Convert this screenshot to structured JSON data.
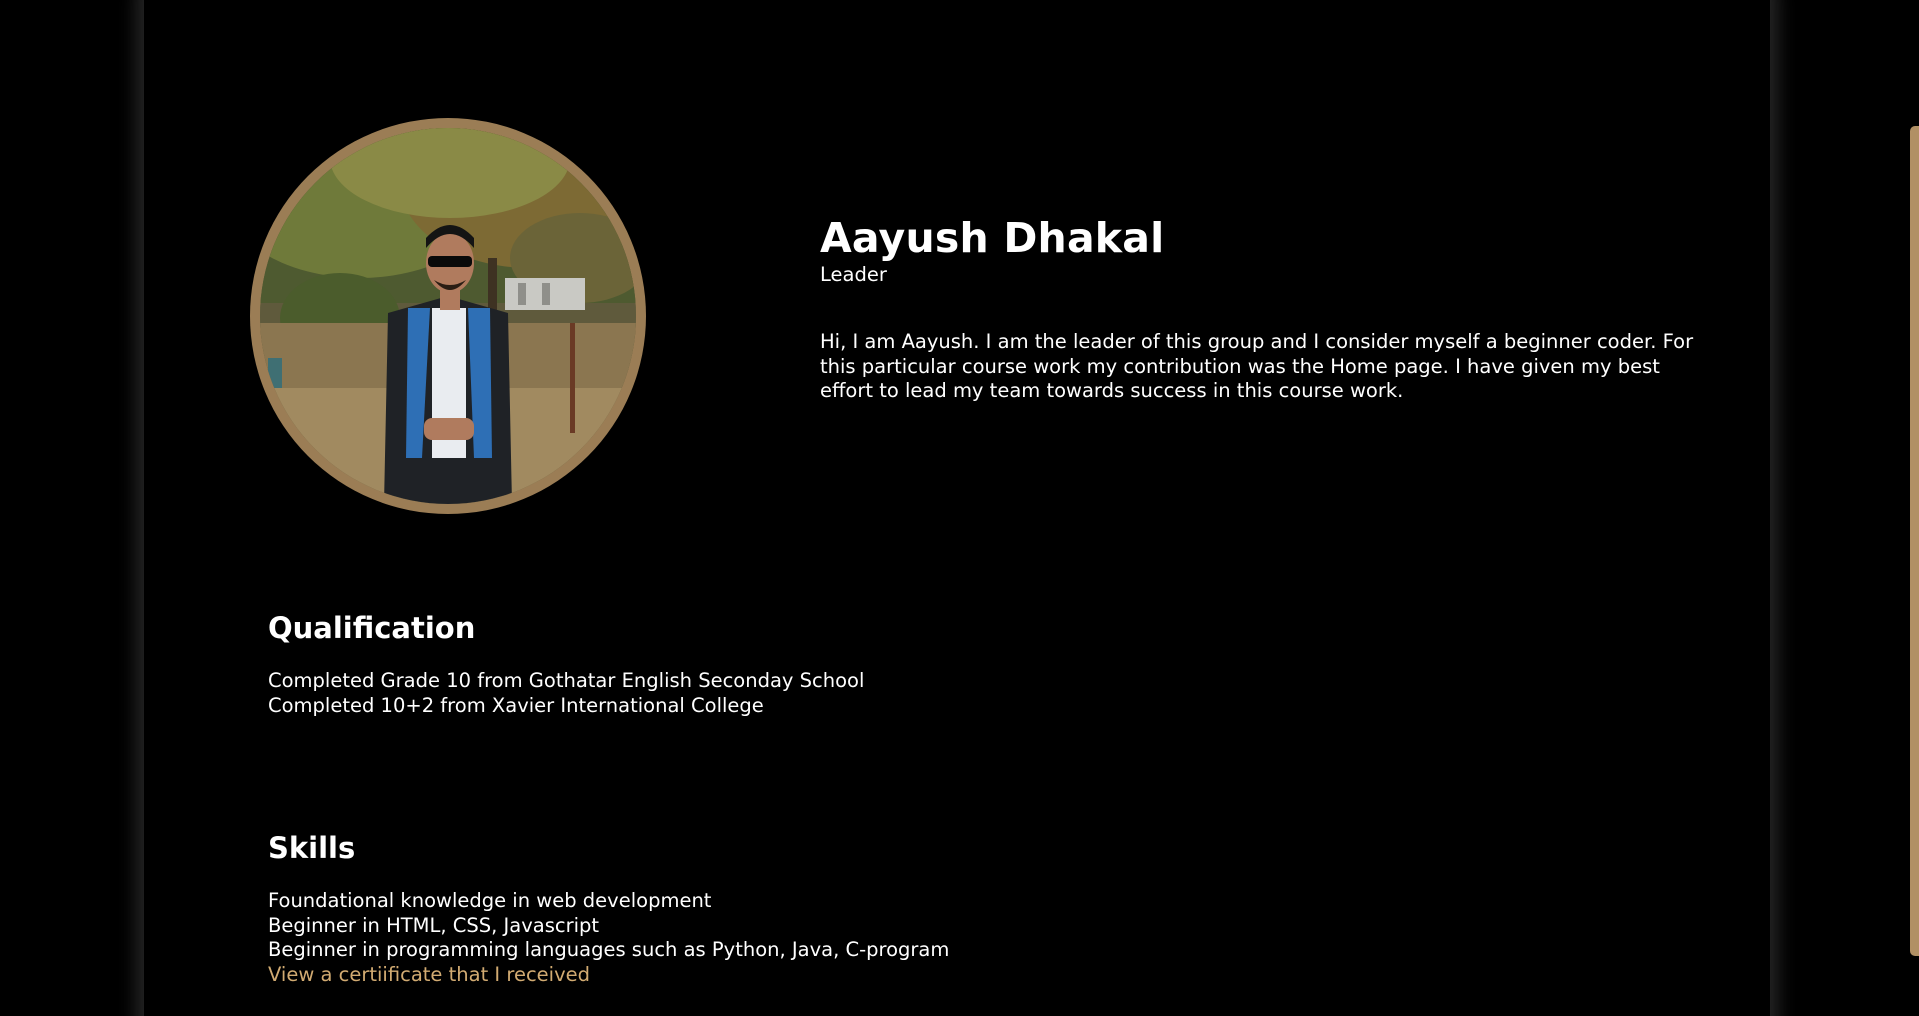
{
  "profile": {
    "photo_icon": "profile-photo",
    "ring_color": "#9b7d55",
    "name": "Aayush Dhakal",
    "role": "Leader",
    "bio": "Hi, I am Aayush. I am the leader of this group and I consider myself a beginner coder. For this particular course work my contribution was the Home page. I have given my best effort to lead my team towards success in this course work."
  },
  "qualification": {
    "title": "Qualification",
    "items": [
      "Completed Grade 10 from Gothatar English Seconday School",
      "Completed 10+2 from Xavier International College"
    ]
  },
  "skills": {
    "title": "Skills",
    "items": [
      "Foundational knowledge in web development",
      "Beginner in HTML, CSS, Javascript",
      "Beginner in programming languages such as Python, Java, C-program"
    ],
    "certificate_link": "View a certiificate that I received",
    "link_color": "#d2ab72"
  },
  "colors": {
    "background": "#000000",
    "accent": "#b19064"
  }
}
